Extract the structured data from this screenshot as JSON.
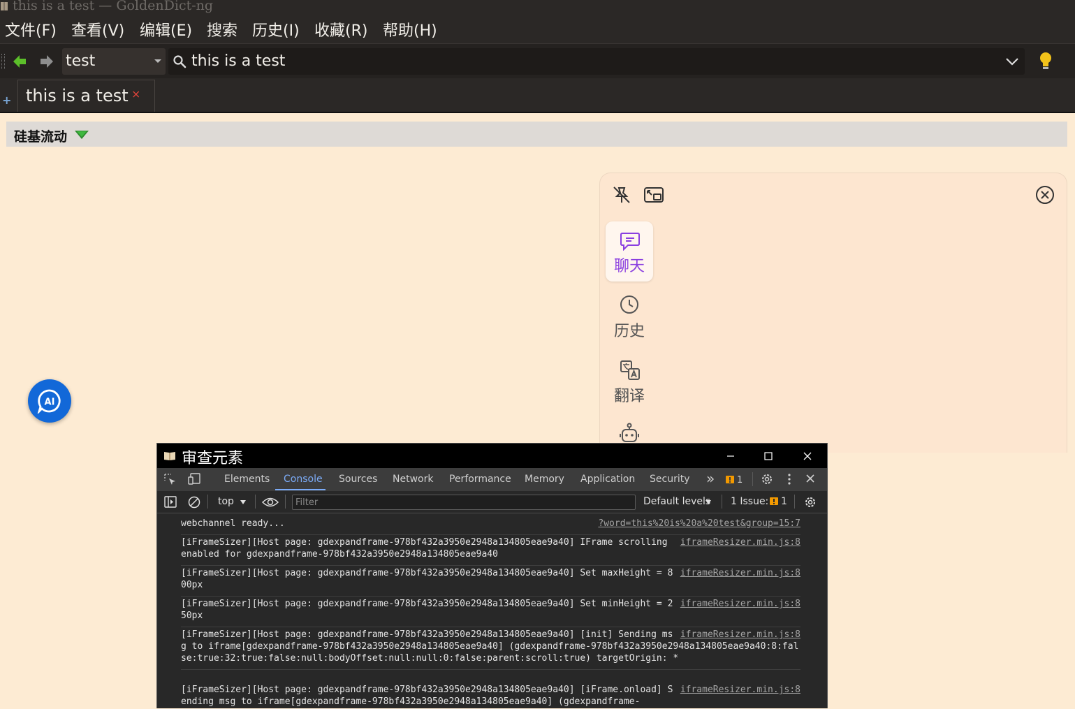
{
  "window": {
    "title": "this is a test — GoldenDict-ng"
  },
  "menu": {
    "items": [
      "文件(F)",
      "查看(V)",
      "编辑(E)",
      "搜索",
      "历史(I)",
      "收藏(R)",
      "帮助(H)"
    ]
  },
  "toolbar": {
    "group": "test",
    "search_value": "this is a test"
  },
  "tabs": [
    {
      "label": "this is a test",
      "close": "×"
    }
  ],
  "dictionary": {
    "name": "硅基流动"
  },
  "ai_panel": {
    "sidebar": [
      "聊天",
      "历史",
      "翻译"
    ],
    "accent": "#8a3fe0"
  },
  "ai_button": {
    "label": "AI"
  },
  "devtools": {
    "title": "审查元素",
    "tabs": [
      "Elements",
      "Console",
      "Sources",
      "Network",
      "Performance",
      "Memory",
      "Application",
      "Security"
    ],
    "active_tab": "Console",
    "overflow": "»",
    "warnings_count": "1",
    "context": "top",
    "filter_placeholder": "Filter",
    "levels": "Default levels",
    "issues_label": "1 Issue:",
    "issues_count": "1",
    "logs": [
      {
        "message": "webchannel ready...",
        "source": "?word=this%20is%20a%20test&group=15:7"
      },
      {
        "message": "[iFrameSizer][Host page: gdexpandframe-978bf432a3950e2948a134805eae9a40] IFrame scrolling enabled for gdexpandframe-978bf432a3950e2948a134805eae9a40",
        "source": "iframeResizer.min.js:8"
      },
      {
        "message": "[iFrameSizer][Host page: gdexpandframe-978bf432a3950e2948a134805eae9a40] Set maxHeight = 800px",
        "source": "iframeResizer.min.js:8"
      },
      {
        "message": "[iFrameSizer][Host page: gdexpandframe-978bf432a3950e2948a134805eae9a40] Set minHeight = 250px",
        "source": "iframeResizer.min.js:8"
      },
      {
        "message": "[iFrameSizer][Host page: gdexpandframe-978bf432a3950e2948a134805eae9a40] [init] Sending msg to iframe[gdexpandframe-978bf432a3950e2948a134805eae9a40] (gdexpandframe-978bf432a3950e2948a134805eae9a40:8:false:true:32:true:false:null:bodyOffset:null:null:0:false:parent:scroll:true) targetOrigin: *",
        "source": "iframeResizer.min.js:8"
      },
      {
        "message": "[iFrameSizer][Host page: gdexpandframe-978bf432a3950e2948a134805eae9a40] [iFrame.onload] Sending msg to iframe[gdexpandframe-978bf432a3950e2948a134805eae9a40] (gdexpandframe-",
        "source": "iframeResizer.min.js:8"
      }
    ]
  }
}
